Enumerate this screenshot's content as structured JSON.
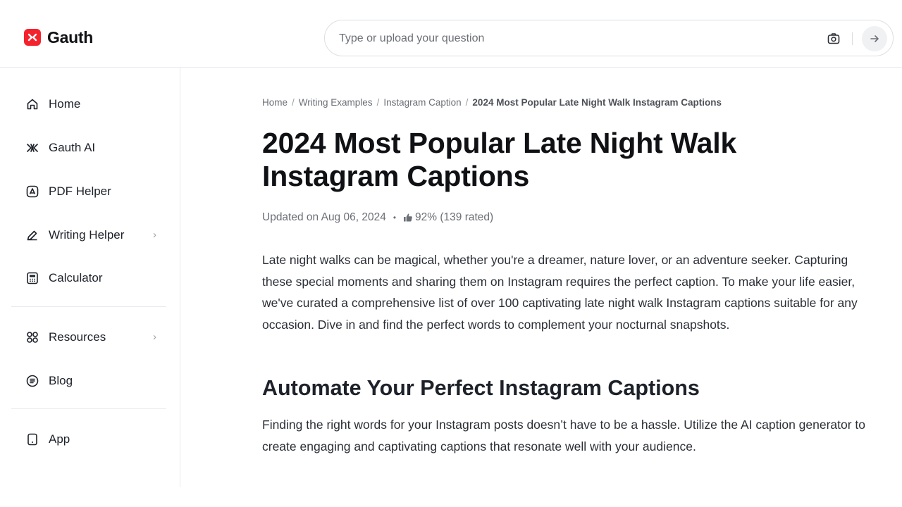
{
  "brand": {
    "name": "Gauth",
    "accent_color": "#f5222d",
    "logo_icon": "gauth-logo-icon"
  },
  "search": {
    "placeholder": "Type or upload your question",
    "camera_icon": "camera-icon",
    "submit_icon": "arrow-right-icon"
  },
  "sidebar": {
    "items": [
      {
        "label": "Home",
        "icon": "home-icon"
      },
      {
        "label": "Gauth AI",
        "icon": "gauth-ai-icon"
      },
      {
        "label": "PDF Helper",
        "icon": "pdf-icon"
      },
      {
        "label": "Writing Helper",
        "icon": "pencil-icon",
        "has_submenu": true
      },
      {
        "label": "Calculator",
        "icon": "calculator-icon"
      },
      {
        "label": "Resources",
        "icon": "grid-icon",
        "has_submenu": true
      },
      {
        "label": "Blog",
        "icon": "blog-icon"
      },
      {
        "label": "App",
        "icon": "phone-icon"
      }
    ],
    "chevron": "›"
  },
  "breadcrumb": {
    "items": [
      "Home",
      "Writing Examples",
      "Instagram Caption"
    ],
    "current": "2024 Most Popular Late Night Walk Instagram Captions",
    "separator": "/"
  },
  "article": {
    "title": "2024 Most Popular Late Night Walk Instagram Captions",
    "updated": "Updated on Aug 06, 2024",
    "dot": "•",
    "rating": "92% (139 rated)",
    "intro": "Late night walks can be magical, whether you're a dreamer, nature lover, or an adventure seeker. Capturing these special moments and sharing them on Instagram requires the perfect caption. To make your life easier, we've curated a comprehensive list of over 100 captivating late night walk Instagram captions suitable for any occasion. Dive in and find the perfect words to complement your nocturnal snapshots.",
    "section_heading": "Automate Your Perfect Instagram Captions",
    "section_text": "Finding the right words for your Instagram posts doesn’t have to be a hassle. Utilize the AI caption generator to create engaging and captivating captions that resonate well with your audience."
  }
}
